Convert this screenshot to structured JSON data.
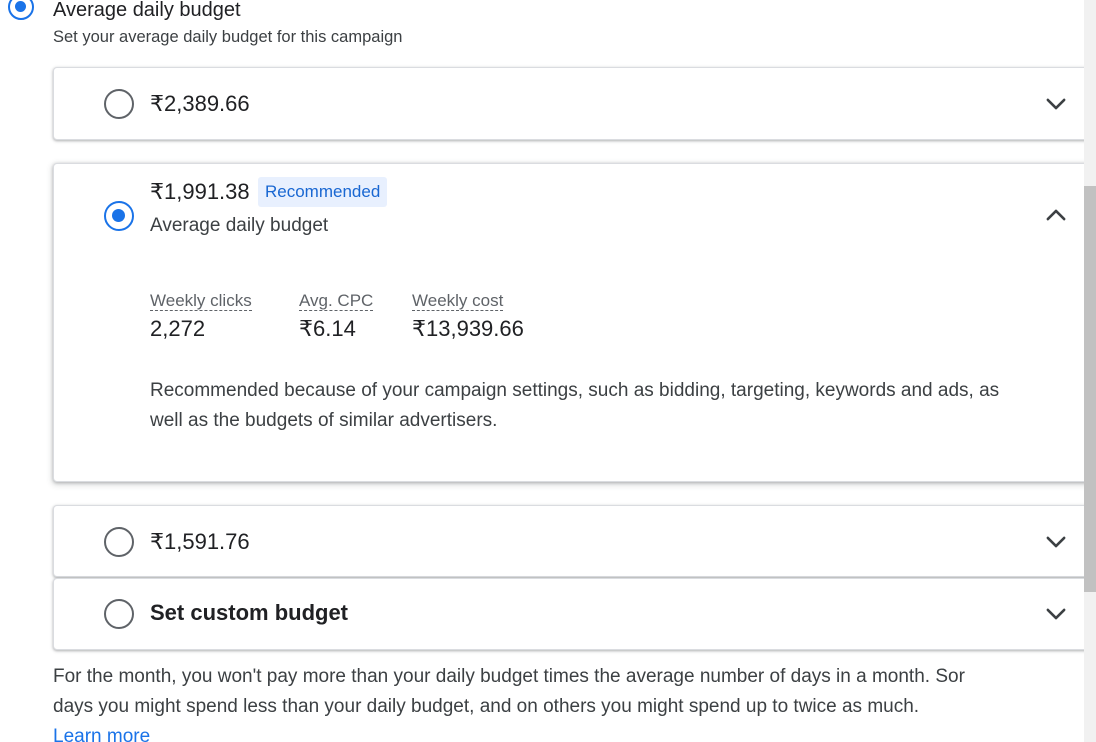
{
  "header": {
    "title": "Average daily budget",
    "subtitle": "Set your average daily budget for this campaign"
  },
  "options": [
    {
      "amount": "₹2,389.66",
      "selected": false,
      "expanded": false
    },
    {
      "amount": "₹1,991.38",
      "badge": "Recommended",
      "caption": "Average daily budget",
      "selected": true,
      "expanded": true,
      "metrics": [
        {
          "label": "Weekly clicks",
          "value": "2,272"
        },
        {
          "label": "Avg. CPC",
          "value": "₹6.14"
        },
        {
          "label": "Weekly cost",
          "value": "₹13,939.66"
        }
      ],
      "explanation": "Recommended because of your campaign settings, such as bidding, targeting, keywords and ads, as well as the budgets of similar advertisers."
    },
    {
      "amount": "₹1,591.76",
      "selected": false,
      "expanded": false
    },
    {
      "amount": "Set custom budget",
      "selected": false,
      "expanded": false
    }
  ],
  "footer": {
    "line1": "For the month, you won't pay more than your daily budget times the average number of days in a month. Sor",
    "line2": "days you might spend less than your daily budget, and on others you might spend up to twice as much.",
    "learn_more": "Learn more"
  },
  "colors": {
    "accent": "#1a73e8",
    "badge_bg": "#e8f0fe",
    "badge_text": "#1967d2",
    "border": "#dadce0"
  },
  "icons": {
    "expand": "chevron-down-icon",
    "collapse": "chevron-up-icon"
  }
}
